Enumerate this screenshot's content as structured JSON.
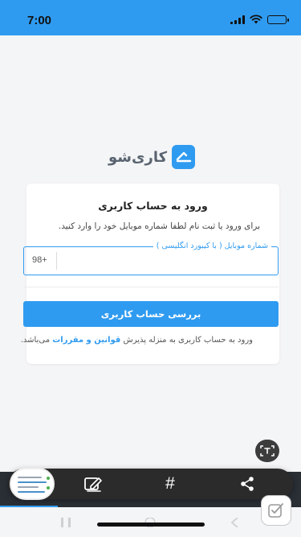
{
  "status_bar": {
    "time": "7:00"
  },
  "logo": {
    "brand_name": "کاری‌شو"
  },
  "login_card": {
    "title": "ورود به حساب کاربری",
    "description": "برای ورود یا ثبت نام لطفا شماره موبایل خود را وارد کنید.",
    "phone_field": {
      "label": "شماره موبایل ( با کیبورد انگلیسی )",
      "prefix": "98+",
      "value": ""
    },
    "submit_label": "بررسی حساب کاربری",
    "terms_prefix": "ورود به حساب کاربری به منزله پذیرش ",
    "terms_link": "قوانین و مقررات",
    "terms_suffix": " می‌باشد."
  },
  "tabs": [
    "home-icon",
    "card-icon",
    "book-icon",
    "document-edit-icon"
  ],
  "toolbar": {
    "hashtag_label": "#",
    "icons": [
      "share-icon",
      "hashtag-icon",
      "edit-note-icon",
      "text-scan-icon"
    ]
  },
  "colors": {
    "primary": "#2f9bf0",
    "background": "#f4f5f7",
    "toolbar": "#2b2b2b"
  }
}
